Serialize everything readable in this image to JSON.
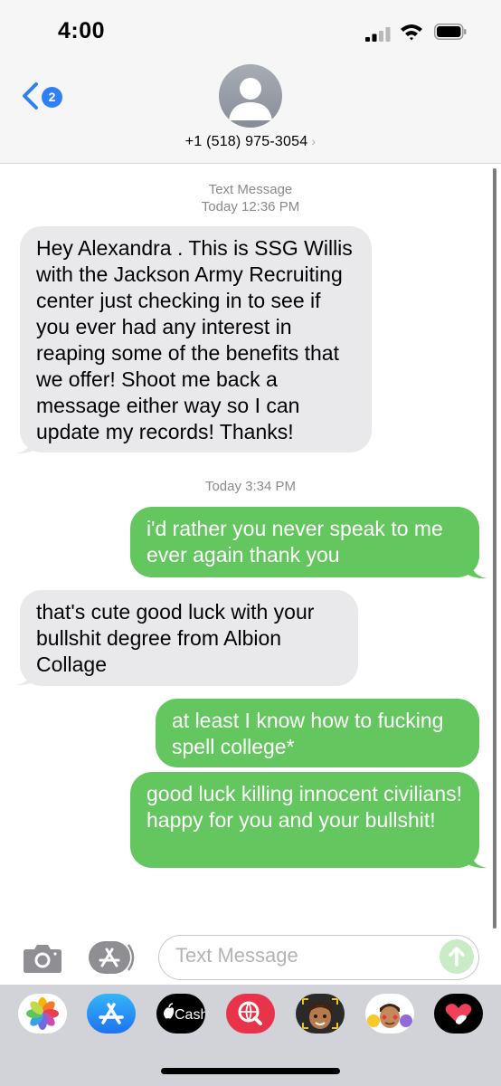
{
  "status_bar": {
    "time": "4:00"
  },
  "nav": {
    "back_badge": "2",
    "contact": "+1 (518) 975-3054"
  },
  "thread": {
    "stamp1_type": "Text Message",
    "stamp1_time": "Today 12:36 PM",
    "msg1": "Hey Alexandra . This is SSG Willis with the Jackson Army Recruiting center just checking in to see if you ever had any interest in reaping some of the benefits that we offer! Shoot me back a message either way so I can update my records! Thanks!",
    "stamp2_time": "Today 3:34 PM",
    "msg2": "i'd rather you never speak to me ever again thank you",
    "msg3": "that's cute good luck with your bullshit degree from Albion Collage",
    "msg4": "at least I know how to fucking spell college*",
    "msg5": "good luck killing innocent civilians! happy for you and your bullshit!"
  },
  "compose": {
    "placeholder": "Text Message"
  },
  "app_drawer": {
    "items": [
      "photos-icon",
      "app-store-icon",
      "apple-cash-icon",
      "web-search-icon",
      "memoji-icon",
      "memoji-stickers-icon",
      "digital-touch-icon"
    ],
    "cash_label": "Cash"
  },
  "colors": {
    "outgoing": "#63c65e",
    "incoming": "#e9e9eb",
    "accent": "#2f80f5"
  }
}
